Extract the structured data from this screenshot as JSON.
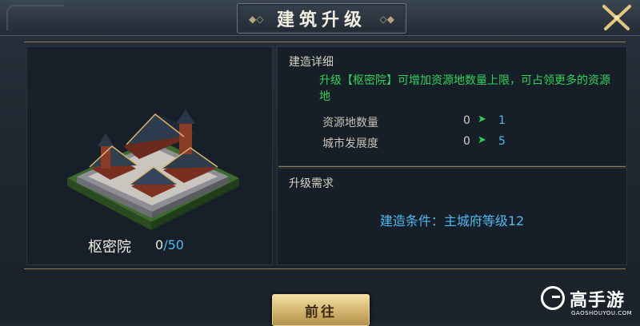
{
  "header": {
    "title": "建筑升级",
    "close_icon": "crossed-swords-icon"
  },
  "building": {
    "name": "枢密院",
    "level_current": "0",
    "level_separator": "/",
    "level_max": "50",
    "image_icon": "palace-building-icon"
  },
  "details": {
    "heading": "建造详细",
    "description": "升级【枢密院】可增加资源地数量上限，可占领更多的资源地",
    "stats": [
      {
        "label": "资源地数量",
        "from": "0",
        "to": "1"
      },
      {
        "label": "城市发展度",
        "from": "0",
        "to": "5"
      }
    ]
  },
  "requirements": {
    "heading": "升级需求",
    "condition": "建造条件：主城府等级12"
  },
  "actions": {
    "go_label": "前往"
  },
  "watermark": {
    "brand": "高手游",
    "url": "GAOSHOUYOU.COM"
  },
  "colors": {
    "accent_green": "#2ed35a",
    "accent_blue": "#4fb8f0",
    "gold": "#8f7b55",
    "button_gold": "#d3b46c"
  }
}
